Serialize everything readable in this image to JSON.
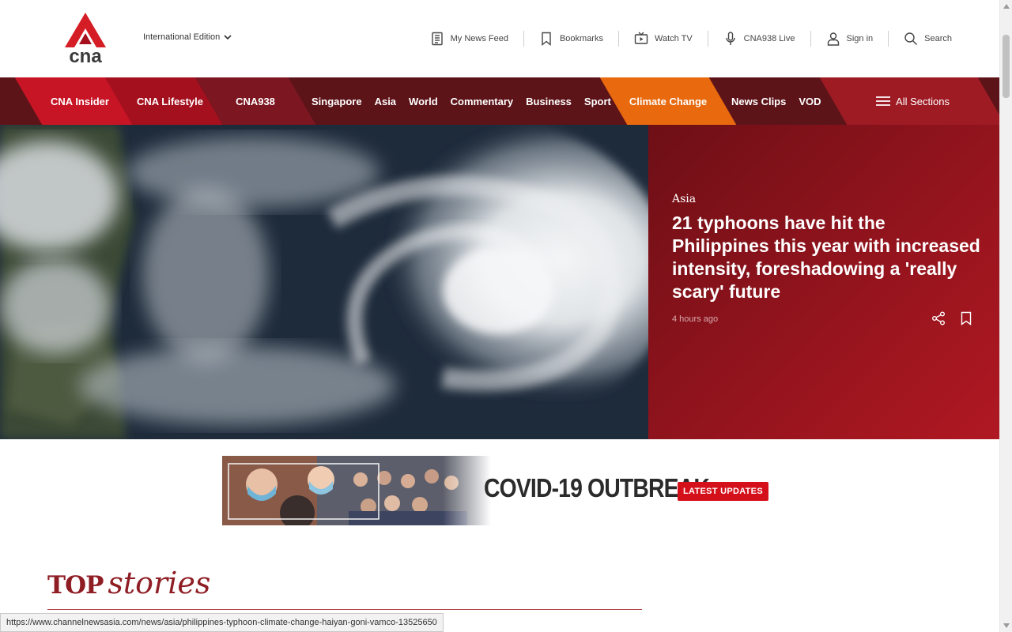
{
  "header": {
    "logo_text": "cna",
    "edition": "International Edition",
    "utility": [
      {
        "label": "My News Feed",
        "icon": "newsfeed-icon"
      },
      {
        "label": "Bookmarks",
        "icon": "bookmark-icon"
      },
      {
        "label": "Watch TV",
        "icon": "tv-icon"
      },
      {
        "label": "CNA938 Live",
        "icon": "microphone-icon"
      },
      {
        "label": "Sign in",
        "icon": "user-icon"
      },
      {
        "label": "Search",
        "icon": "search-icon"
      }
    ]
  },
  "nav": {
    "insider": "CNA Insider",
    "lifestyle": "CNA Lifestyle",
    "cna938": "CNA938",
    "links": [
      "Singapore",
      "Asia",
      "World",
      "Commentary",
      "Business",
      "Sport"
    ],
    "climate": "Climate Change",
    "newsclips": "News Clips",
    "vod": "VOD",
    "all_sections": "All Sections"
  },
  "hero": {
    "category": "Asia",
    "title": "21 typhoons have hit the Philippines this year with increased intensity, foreshadowing a 'really scary' future",
    "time": "4 hours ago"
  },
  "covid_banner": {
    "title": "COVID-19 OUTBREAK",
    "badge": "LATEST UPDATES"
  },
  "top_stories": {
    "word1": "TOP",
    "word2": "stories"
  },
  "status_url": "https://www.channelnewsasia.com/news/asia/philippines-typhoon-climate-change-haiyan-goni-vamco-13525650",
  "colors": {
    "brand_red": "#c71525",
    "nav_dark": "#5d1419",
    "climate_orange": "#e8690e",
    "hero_panel": "#8d131c"
  }
}
